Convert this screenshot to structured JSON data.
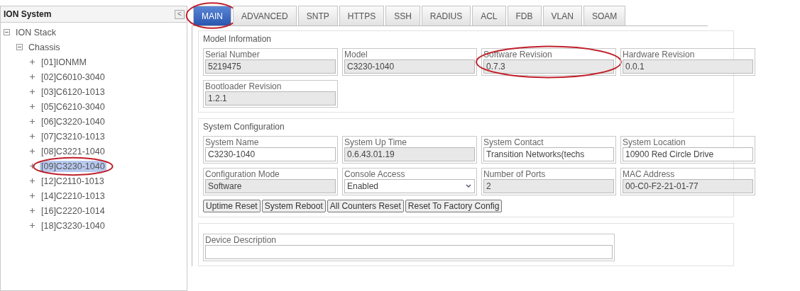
{
  "sidebar": {
    "title": "ION System",
    "collapse_button": "<",
    "tree": [
      {
        "label": "ION Stack",
        "expanded": true,
        "children": [
          {
            "label": "Chassis",
            "expanded": true,
            "children": [
              {
                "label": "[01]IONMM",
                "expanded": false,
                "selected": false,
                "circled": false
              },
              {
                "label": "[02]C6010-3040",
                "expanded": false,
                "selected": false,
                "circled": false
              },
              {
                "label": "[03]C6120-1013",
                "expanded": false,
                "selected": false,
                "circled": false
              },
              {
                "label": "[05]C6210-3040",
                "expanded": false,
                "selected": false,
                "circled": false
              },
              {
                "label": "[06]C3220-1040",
                "expanded": false,
                "selected": false,
                "circled": false
              },
              {
                "label": "[07]C3210-1013",
                "expanded": false,
                "selected": false,
                "circled": false
              },
              {
                "label": "[08]C3221-1040",
                "expanded": false,
                "selected": false,
                "circled": false
              },
              {
                "label": "[09]C3230-1040",
                "expanded": false,
                "selected": true,
                "circled": true
              },
              {
                "label": "[12]C2110-1013",
                "expanded": false,
                "selected": false,
                "circled": false
              },
              {
                "label": "[14]C2210-1013",
                "expanded": false,
                "selected": false,
                "circled": false
              },
              {
                "label": "[16]C2220-1014",
                "expanded": false,
                "selected": false,
                "circled": false
              },
              {
                "label": "[18]C3230-1040",
                "expanded": false,
                "selected": false,
                "circled": false
              }
            ]
          }
        ]
      }
    ]
  },
  "tabs": [
    {
      "label": "MAIN",
      "selected": true,
      "circled": true
    },
    {
      "label": "ADVANCED",
      "selected": false,
      "circled": false
    },
    {
      "label": "SNTP",
      "selected": false,
      "circled": false
    },
    {
      "label": "HTTPS",
      "selected": false,
      "circled": false
    },
    {
      "label": "SSH",
      "selected": false,
      "circled": false
    },
    {
      "label": "RADIUS",
      "selected": false,
      "circled": false
    },
    {
      "label": "ACL",
      "selected": false,
      "circled": false
    },
    {
      "label": "FDB",
      "selected": false,
      "circled": false
    },
    {
      "label": "VLAN",
      "selected": false,
      "circled": false
    },
    {
      "label": "SOAM",
      "selected": false,
      "circled": false
    }
  ],
  "sections": [
    {
      "title": "Model Information",
      "fields": [
        {
          "label": "Serial Number",
          "value": "5219475",
          "kind": "readonly",
          "circled": false
        },
        {
          "label": "Model",
          "value": "C3230-1040",
          "kind": "readonly",
          "circled": false
        },
        {
          "label": "Software Revision",
          "value": "0.7.3",
          "kind": "readonly",
          "circled": true
        },
        {
          "label": "Hardware Revision",
          "value": "0.0.1",
          "kind": "readonly",
          "circled": false
        },
        {
          "label": "Bootloader Revision",
          "value": "1.2.1",
          "kind": "readonly",
          "circled": false
        }
      ]
    },
    {
      "title": "System Configuration",
      "fields": [
        {
          "label": "System Name",
          "value": "C3230-1040",
          "kind": "text",
          "circled": false
        },
        {
          "label": "System Up Time",
          "value": "0.6.43.01.19",
          "kind": "readonly",
          "circled": false
        },
        {
          "label": "System Contact",
          "value": "Transition Networks(techs",
          "kind": "text",
          "circled": false
        },
        {
          "label": "System Location",
          "value": "10900 Red Circle Drive",
          "kind": "text",
          "circled": false
        },
        {
          "label": "Configuration Mode",
          "value": "Software",
          "kind": "readonly",
          "circled": false
        },
        {
          "label": "Console Access",
          "value": "Enabled",
          "kind": "select",
          "circled": false
        },
        {
          "label": "Number of Ports",
          "value": "2",
          "kind": "readonly",
          "circled": false
        },
        {
          "label": "MAC Address",
          "value": "00-C0-F2-21-01-77",
          "kind": "readonly",
          "circled": false
        }
      ],
      "buttons": [
        "Uptime Reset",
        "System Reboot",
        "All Counters Reset",
        "Reset To Factory Config"
      ]
    }
  ],
  "description": {
    "label": "Device Description"
  }
}
